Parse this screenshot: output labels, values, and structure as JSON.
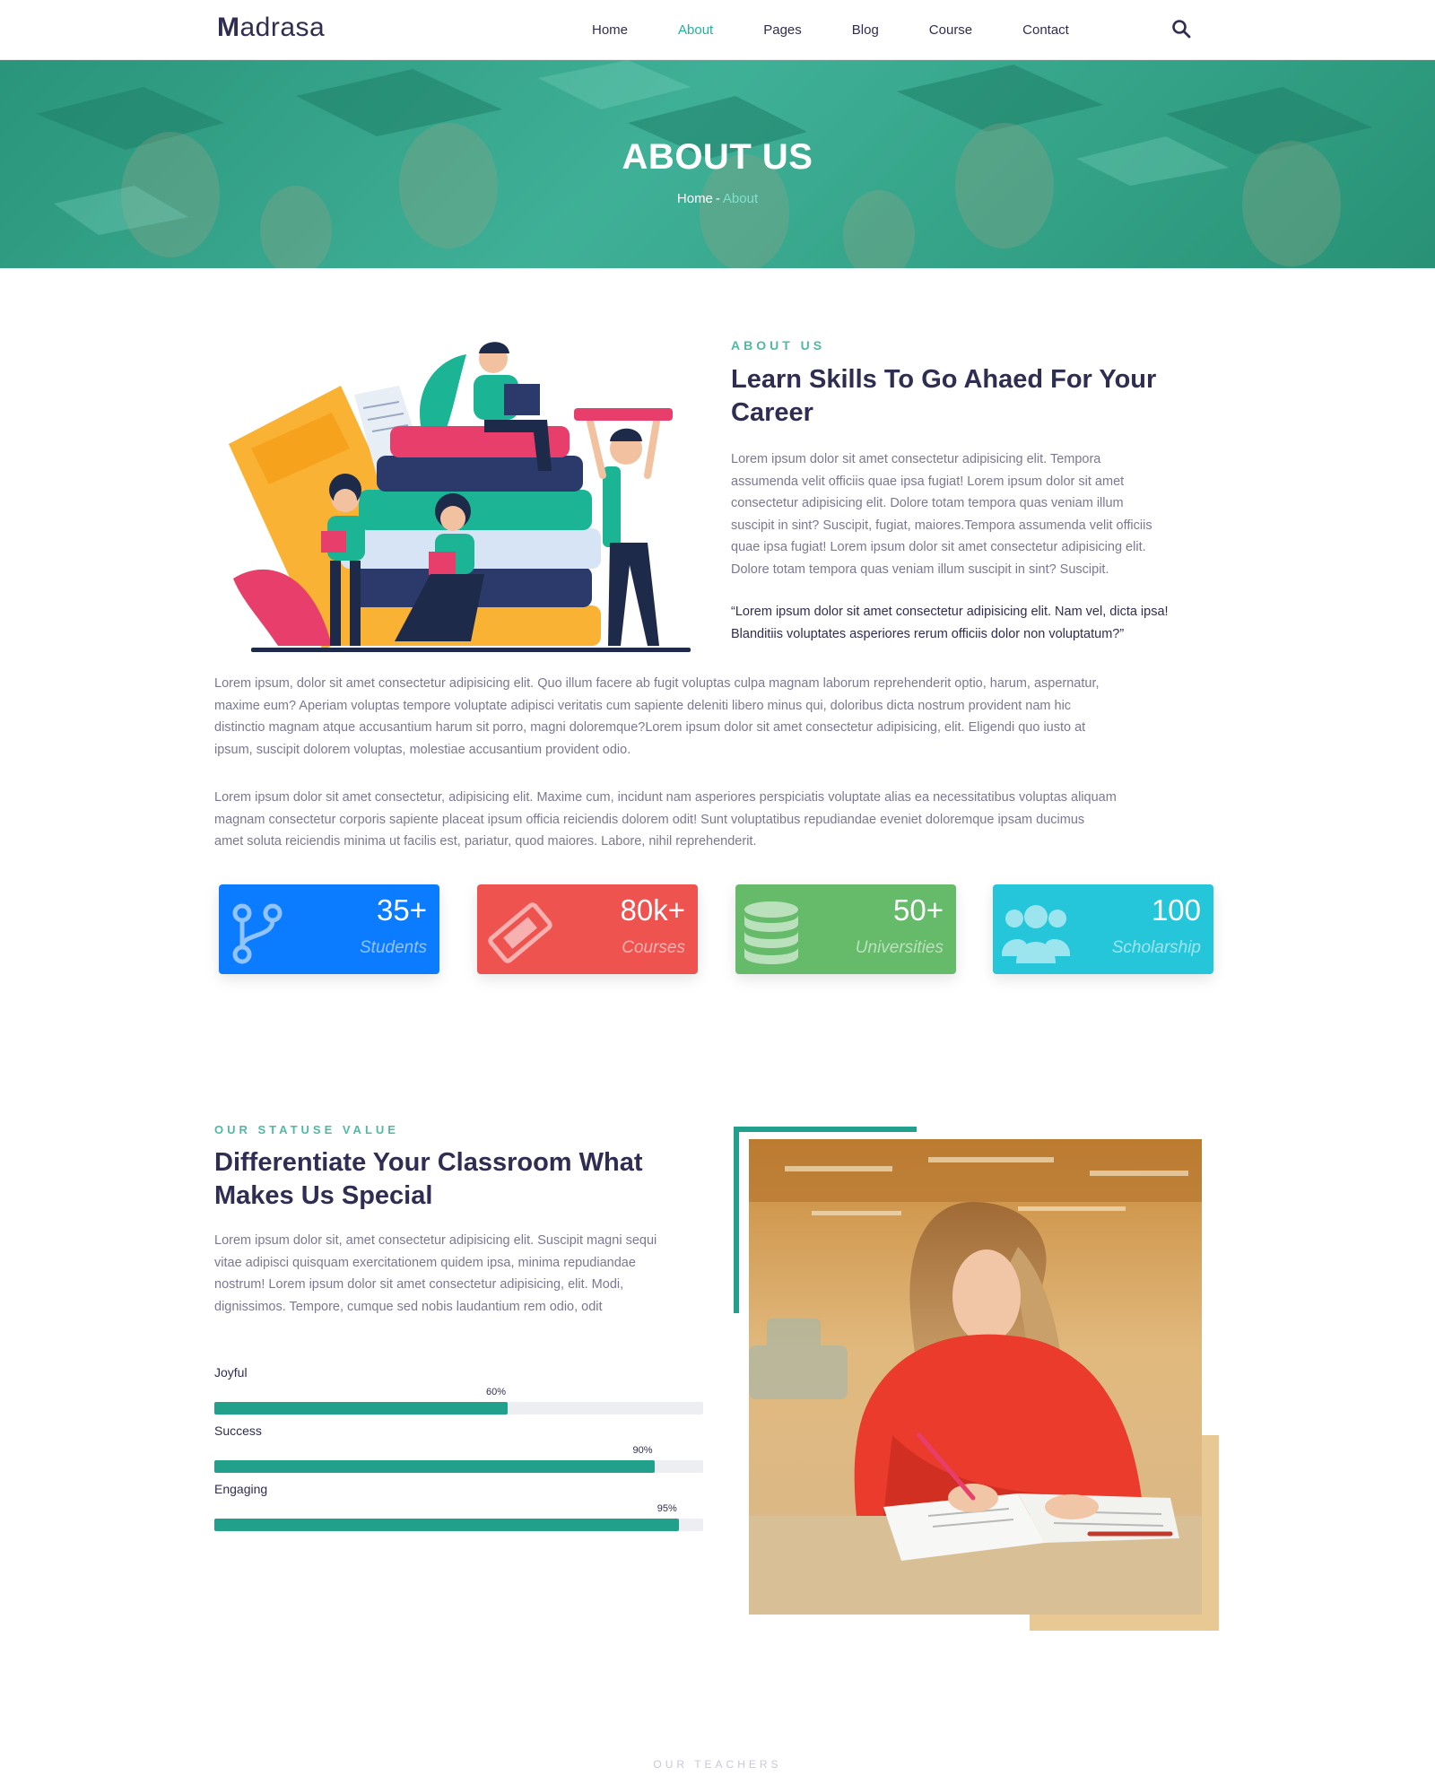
{
  "brand": {
    "name_bold": "M",
    "name_rest": "adrasa"
  },
  "nav": {
    "items": [
      {
        "label": "Home",
        "active": false
      },
      {
        "label": "About",
        "active": true
      },
      {
        "label": "Pages",
        "active": false
      },
      {
        "label": "Blog",
        "active": false
      },
      {
        "label": "Course",
        "active": false
      },
      {
        "label": "Contact",
        "active": false
      }
    ],
    "search_icon": "search-icon"
  },
  "hero": {
    "title": "ABOUT US",
    "breadcrumb": {
      "home": "Home",
      "separator": "-",
      "current": "About"
    }
  },
  "about": {
    "eyebrow": "ABOUT US",
    "heading_line1": "Learn Skills To Go Ahaed For Your",
    "heading_line2": "Career",
    "para1_lines": [
      "Lorem ipsum dolor sit amet consectetur adipisicing elit. Tempora",
      "assumenda velit officiis quae ipsa fugiat! Lorem ipsum dolor sit amet",
      "consectetur adipisicing elit. Dolore totam tempora quas veniam illum",
      "suscipit in sint? Suscipit, fugiat, maiores.Tempora assumenda velit officiis",
      "quae ipsa fugiat! Lorem ipsum dolor sit amet consectetur adipisicing elit.",
      "Dolore totam tempora quas veniam illum suscipit in sint? Suscipit."
    ],
    "quote_lines": [
      "“Lorem ipsum dolor sit amet consectetur adipisicing elit. Nam vel, dicta ipsa!",
      "Blanditiis voluptates asperiores rerum officiis dolor non voluptatum?”"
    ],
    "para2_lines": [
      "Lorem ipsum, dolor sit amet consectetur adipisicing elit. Quo illum facere ab fugit voluptas culpa magnam laborum reprehenderit optio, harum, aspernatur,",
      "maxime eum? Aperiam voluptas tempore voluptate adipisci veritatis cum sapiente deleniti libero minus qui, doloribus dicta nostrum provident nam hic",
      "distinctio magnam atque accusantium harum sit porro, magni doloremque?Lorem ipsum dolor sit amet consectetur adipisicing, elit. Eligendi quo iusto at",
      "ipsum, suscipit dolorem voluptas, molestiae accusantium provident odio."
    ],
    "para3_lines": [
      "Lorem ipsum dolor sit amet consectetur, adipisicing elit. Maxime cum, incidunt nam asperiores perspiciatis voluptate alias ea necessitatibus voluptas aliquam",
      "magnam consectetur corporis sapiente placeat ipsum officia reiciendis dolorem odit! Sunt voluptatibus repudiandae eveniet doloremque ipsam ducimus",
      "amet soluta reiciendis minima ut facilis est, pariatur, quod maiores. Labore, nihil reprehenderit."
    ]
  },
  "stats": [
    {
      "value": "35+",
      "label": "Students",
      "color": "#0b7bff",
      "icon": "code-branch-icon"
    },
    {
      "value": "80k+",
      "label": "Courses",
      "color": "#ef5350",
      "icon": "ticket-icon"
    },
    {
      "value": "50+",
      "label": "Universities",
      "color": "#66bb6a",
      "icon": "database-icon"
    },
    {
      "value": "100",
      "label": "Scholarship",
      "color": "#26c6da",
      "icon": "users-icon"
    }
  ],
  "status": {
    "eyebrow": "OUR STATUSE VALUE",
    "heading_line1": "Differentiate Your Classroom What",
    "heading_line2": "Makes Us Special",
    "para_lines": [
      "Lorem ipsum dolor sit, amet consectetur adipisicing elit. Suscipit magni sequi",
      "vitae adipisci quisquam exercitationem quidem ipsa, minima repudiandae",
      "nostrum! Lorem ipsum dolor sit amet consectetur adipisicing, elit. Modi,",
      "dignissimos. Tempore, cumque sed nobis laudantium rem odio, odit"
    ],
    "bars": [
      {
        "label": "Joyful",
        "percent": 60,
        "percent_text": "60%"
      },
      {
        "label": "Success",
        "percent": 90,
        "percent_text": "90%"
      },
      {
        "label": "Engaging",
        "percent": 95,
        "percent_text": "95%"
      }
    ],
    "accent_color": "#21a08c"
  },
  "footer_peek": "OUR TEACHERS"
}
